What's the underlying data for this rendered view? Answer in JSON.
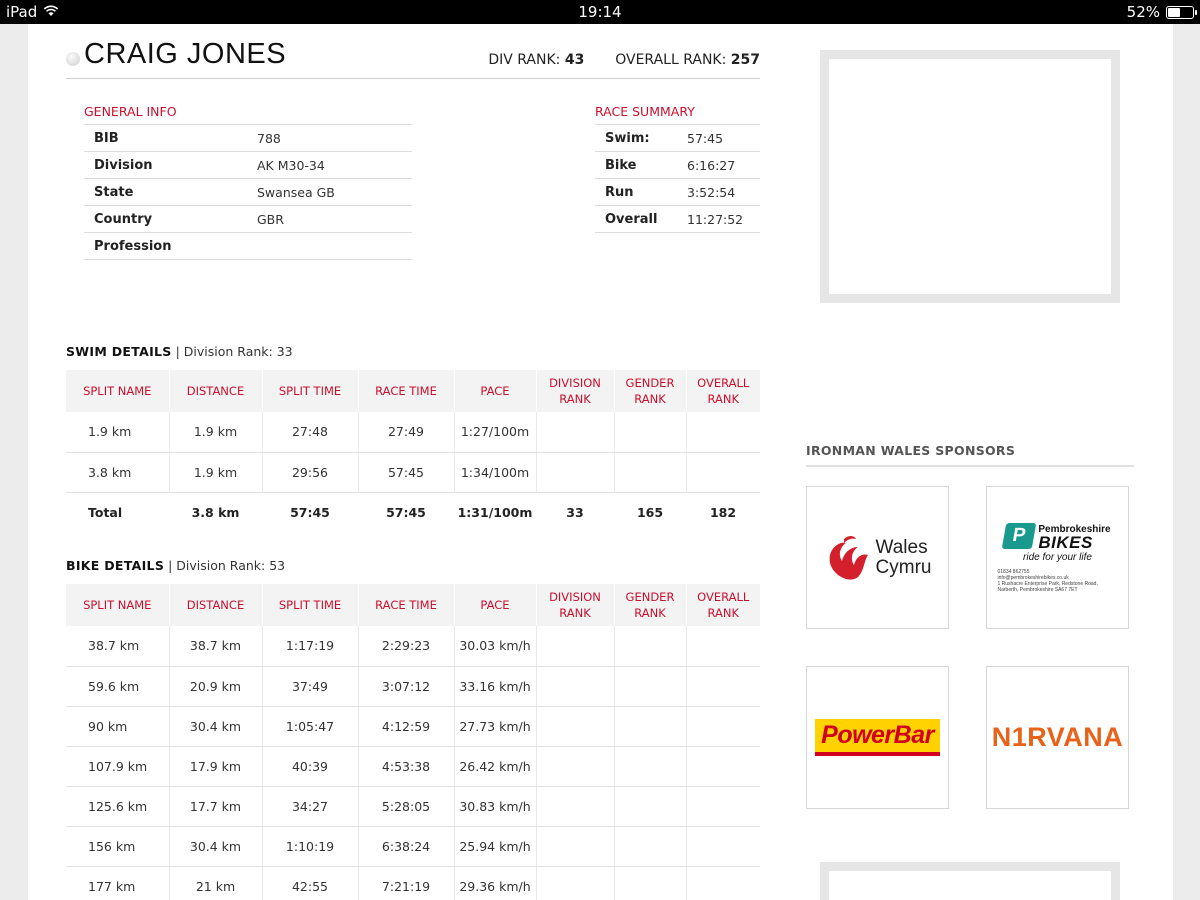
{
  "status_bar": {
    "device": "iPad",
    "time": "19:14",
    "battery": "52%",
    "battery_level": 0.52
  },
  "athlete": {
    "name": "CRAIG JONES",
    "div_rank_label": "DIV RANK:",
    "div_rank": "43",
    "overall_rank_label": "OVERALL RANK:",
    "overall_rank": "257"
  },
  "general_info": {
    "title": "GENERAL INFO",
    "rows": [
      {
        "label": "BIB",
        "value": "788"
      },
      {
        "label": "Division",
        "value": "AK M30-34"
      },
      {
        "label": "State",
        "value": "Swansea GB"
      },
      {
        "label": "Country",
        "value": "GBR"
      },
      {
        "label": "Profession",
        "value": ""
      }
    ]
  },
  "race_summary": {
    "title": "RACE SUMMARY",
    "rows": [
      {
        "label": "Swim:",
        "value": "57:45"
      },
      {
        "label": "Bike",
        "value": "6:16:27"
      },
      {
        "label": "Run",
        "value": "3:52:54"
      },
      {
        "label": "Overall",
        "value": "11:27:52"
      }
    ]
  },
  "columns": [
    "SPLIT NAME",
    "DISTANCE",
    "SPLIT TIME",
    "RACE TIME",
    "PACE",
    "DIVISION RANK",
    "GENDER RANK",
    "OVERALL RANK"
  ],
  "swim": {
    "title": "SWIM DETAILS",
    "rank_text": "Division Rank: 33",
    "rows": [
      [
        "1.9 km",
        "1.9 km",
        "27:48",
        "27:49",
        "1:27/100m",
        "",
        "",
        ""
      ],
      [
        "3.8 km",
        "1.9 km",
        "29:56",
        "57:45",
        "1:34/100m",
        "",
        "",
        ""
      ]
    ],
    "total": [
      "Total",
      "3.8 km",
      "57:45",
      "57:45",
      "1:31/100m",
      "33",
      "165",
      "182"
    ]
  },
  "bike": {
    "title": "BIKE DETAILS",
    "rank_text": "Division Rank: 53",
    "rows": [
      [
        "38.7 km",
        "38.7 km",
        "1:17:19",
        "2:29:23",
        "30.03 km/h",
        "",
        "",
        ""
      ],
      [
        "59.6 km",
        "20.9 km",
        "37:49",
        "3:07:12",
        "33.16 km/h",
        "",
        "",
        ""
      ],
      [
        "90 km",
        "30.4 km",
        "1:05:47",
        "4:12:59",
        "27.73 km/h",
        "",
        "",
        ""
      ],
      [
        "107.9 km",
        "17.9 km",
        "40:39",
        "4:53:38",
        "26.42 km/h",
        "",
        "",
        ""
      ],
      [
        "125.6 km",
        "17.7 km",
        "34:27",
        "5:28:05",
        "30.83 km/h",
        "",
        "",
        ""
      ],
      [
        "156 km",
        "30.4 km",
        "1:10:19",
        "6:38:24",
        "25.94 km/h",
        "",
        "",
        ""
      ],
      [
        "177 km",
        "21 km",
        "42:55",
        "7:21:19",
        "29.36 km/h",
        "",
        "",
        ""
      ]
    ]
  },
  "sponsors": {
    "title": "IRONMAN WALES SPONSORS",
    "wales": {
      "line1": "Wales",
      "line2": "Cymru"
    },
    "pembrokeshire": {
      "name_top": "Pembrokeshire",
      "name_big": "BIKES",
      "tagline": "ride for your life",
      "phone": "01834 862755",
      "email": "info@pembrokeshirebikes.co.uk",
      "address": "1 Rushacre Enterprise Park, Redstone Road, Narberth, Pembrokeshire SA67 7ET"
    },
    "powerbar": "PowerBar",
    "nirvana": "N1RVANA"
  }
}
